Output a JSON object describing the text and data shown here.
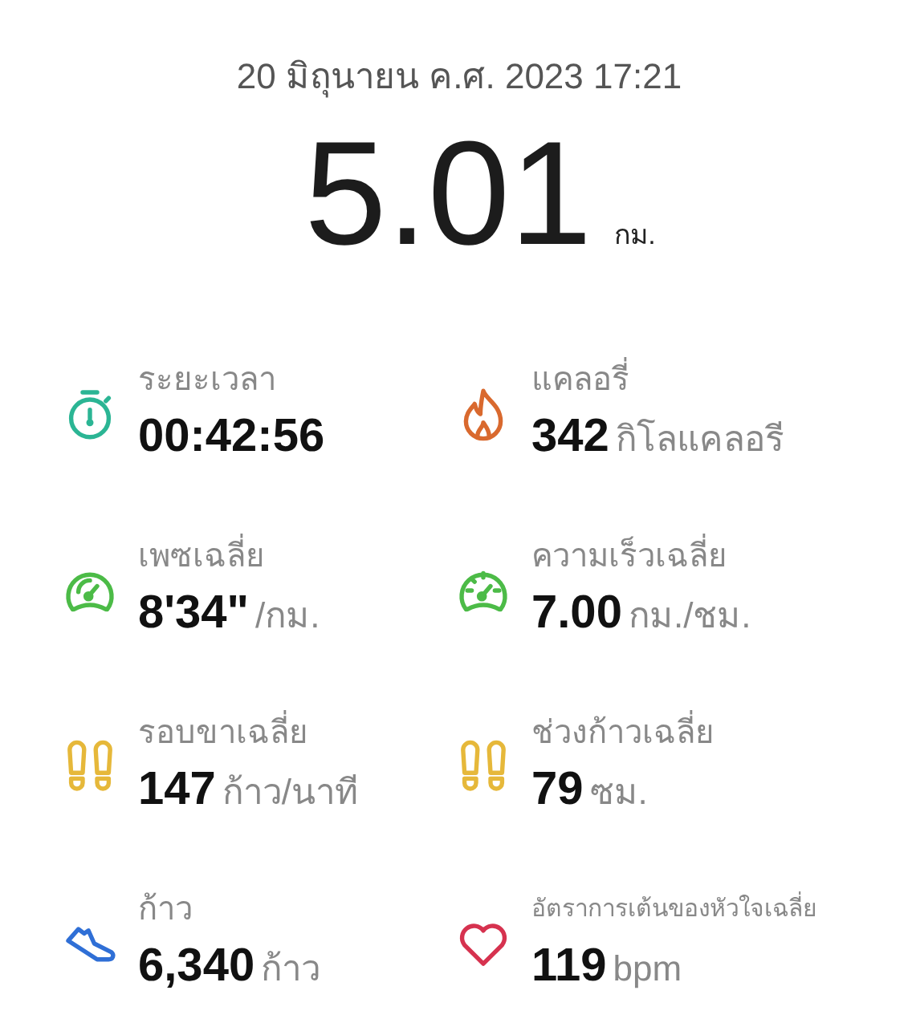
{
  "date": "20 มิถุนายน ค.ศ. 2023 17:21",
  "distance": {
    "value": "5.01",
    "unit": "กม."
  },
  "stats": [
    {
      "kind": "stopwatch",
      "color": "#2bb594",
      "label": "ระยะเวลา",
      "value": "00:42:56"
    },
    {
      "kind": "flame",
      "color": "#d9692e",
      "label": "แคลอรี่",
      "value": "342",
      "unit": "กิโลแคลอรี"
    },
    {
      "kind": "gauge",
      "color": "#4cbb47",
      "label": "เพซเฉลี่ย",
      "value": "8'34\"",
      "unit": "/กม."
    },
    {
      "kind": "speedometer",
      "color": "#4cbb47",
      "label": "ความเร็วเฉลี่ย",
      "value": "7.00",
      "unit": "กม./ชม."
    },
    {
      "kind": "footprints",
      "color": "#e6b83a",
      "label": "รอบขาเฉลี่ย",
      "value": "147",
      "unit": "ก้าว/นาที"
    },
    {
      "kind": "footprints",
      "color": "#e6b83a",
      "label": "ช่วงก้าวเฉลี่ย",
      "value": "79",
      "unit": "ซม."
    },
    {
      "kind": "shoe",
      "color": "#2f6fd6",
      "label": "ก้าว",
      "value": "6,340",
      "unit": "ก้าว"
    },
    {
      "kind": "heart",
      "color": "#d6324f",
      "label": "อัตราการเต้นของหัวใจเฉลี่ย",
      "value": "119",
      "unit": "bpm",
      "small": true
    }
  ]
}
